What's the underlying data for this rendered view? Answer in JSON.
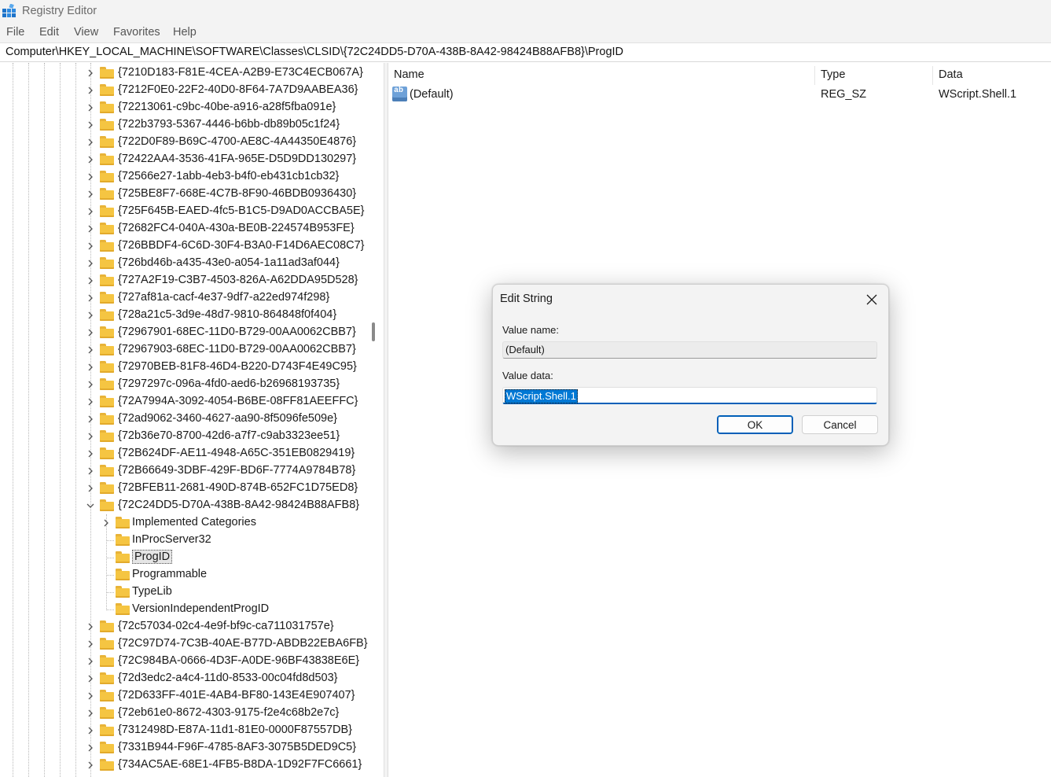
{
  "window": {
    "title": "Registry Editor",
    "icon": "registry-editor-icon"
  },
  "menu": [
    "File",
    "Edit",
    "View",
    "Favorites",
    "Help"
  ],
  "address": "Computer\\HKEY_LOCAL_MACHINE\\SOFTWARE\\Classes\\CLSID\\{72C24DD5-D70A-438B-8A42-98424B88AFB8}\\ProgID",
  "tree": {
    "items_before": [
      "{7210D183-F81E-4CEA-A2B9-E73C4ECB067A}",
      "{7212F0E0-22F2-40D0-8F64-7A7D9AABEA36}",
      "{72213061-c9bc-40be-a916-a28f5fba091e}",
      "{722b3793-5367-4446-b6bb-db89b05c1f24}",
      "{722D0F89-B69C-4700-AE8C-4A44350E4876}",
      "{72422AA4-3536-41FA-965E-D5D9DD130297}",
      "{72566e27-1abb-4eb3-b4f0-eb431cb1cb32}",
      "{725BE8F7-668E-4C7B-8F90-46BDB0936430}",
      "{725F645B-EAED-4fc5-B1C5-D9AD0ACCBA5E}",
      "{72682FC4-040A-430a-BE0B-224574B953FE}",
      "{726BBDF4-6C6D-30F4-B3A0-F14D6AEC08C7}",
      "{726bd46b-a435-43e0-a054-1a11ad3af044}",
      "{727A2F19-C3B7-4503-826A-A62DDA95D528}",
      "{727af81a-cacf-4e37-9df7-a22ed974f298}",
      "{728a21c5-3d9e-48d7-9810-864848f0f404}",
      "{72967901-68EC-11D0-B729-00AA0062CBB7}",
      "{72967903-68EC-11D0-B729-00AA0062CBB7}",
      "{72970BEB-81F8-46D4-B220-D743F4E49C95}",
      "{7297297c-096a-4fd0-aed6-b26968193735}",
      "{72A7994A-3092-4054-B6BE-08FF81AEEFFC}",
      "{72ad9062-3460-4627-aa90-8f5096fe509e}",
      "{72b36e70-8700-42d6-a7f7-c9ab3323ee51}",
      "{72B624DF-AE11-4948-A65C-351EB0829419}",
      "{72B66649-3DBF-429F-BD6F-7774A9784B78}",
      "{72BFEB11-2681-490D-874B-652FC1D75ED8}"
    ],
    "expanded": "{72C24DD5-D70A-438B-8A42-98424B88AFB8}",
    "children": [
      {
        "label": "Implemented Categories",
        "has_children": true
      },
      {
        "label": "InProcServer32",
        "has_children": false
      },
      {
        "label": "ProgID",
        "has_children": false,
        "selected": true
      },
      {
        "label": "Programmable",
        "has_children": false
      },
      {
        "label": "TypeLib",
        "has_children": false
      },
      {
        "label": "VersionIndependentProgID",
        "has_children": false
      }
    ],
    "items_after": [
      "{72c57034-02c4-4e9f-bf9c-ca711031757e}",
      "{72C97D74-7C3B-40AE-B77D-ABDB22EBA6FB}",
      "{72C984BA-0666-4D3F-A0DE-96BF43838E6E}",
      "{72d3edc2-a4c4-11d0-8533-00c04fd8d503}",
      "{72D633FF-401E-4AB4-BF80-143E4E907407}",
      "{72eb61e0-8672-4303-9175-f2e4c68b2e7c}",
      "{7312498D-E87A-11d1-81E0-0000F87557DB}",
      "{7331B944-F96F-4785-8AF3-3075B5DED9C5}",
      "{734AC5AE-68E1-4FB5-B8DA-1D92F7FC6661}"
    ]
  },
  "list": {
    "columns": {
      "name": "Name",
      "type": "Type",
      "data": "Data"
    },
    "rows": [
      {
        "icon": "string-value-icon",
        "name": "(Default)",
        "type": "REG_SZ",
        "data": "WScript.Shell.1"
      }
    ]
  },
  "dialog": {
    "title": "Edit String",
    "value_name_label": "Value name:",
    "value_name": "(Default)",
    "value_data_label": "Value data:",
    "value_data": "WScript.Shell.1",
    "ok_label": "OK",
    "cancel_label": "Cancel"
  },
  "colors": {
    "folder": "#f5c542",
    "accent": "#005fb8",
    "selection": "#0078d4"
  }
}
